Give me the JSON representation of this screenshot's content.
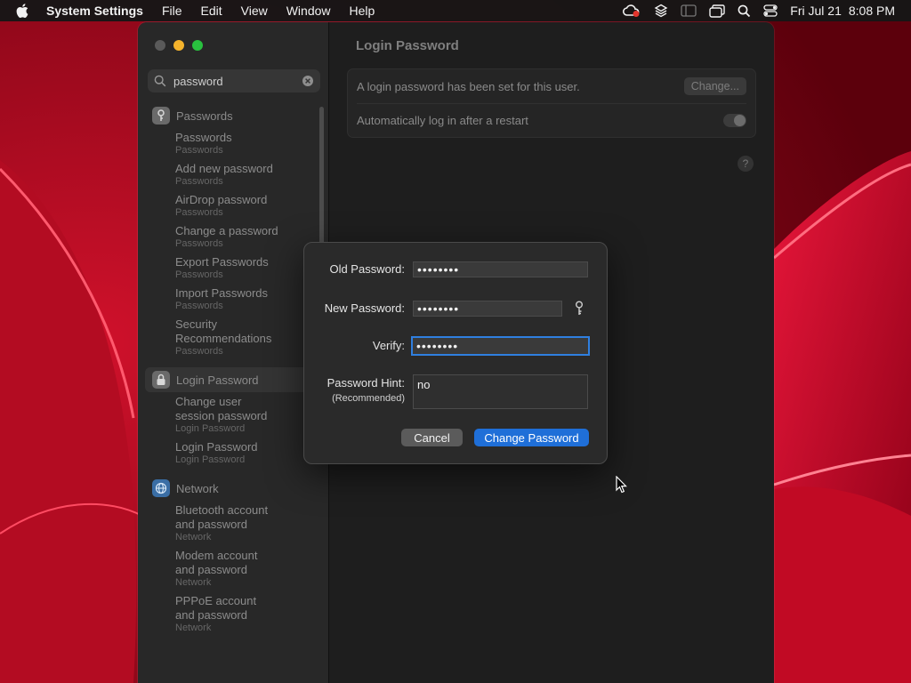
{
  "menubar": {
    "app_name": "System Settings",
    "menus": [
      "File",
      "Edit",
      "View",
      "Window",
      "Help"
    ],
    "date": "Fri Jul 21",
    "time": "8:08 PM"
  },
  "sidebar": {
    "search_value": "password",
    "groups": [
      {
        "category": "Passwords",
        "results": [
          {
            "title": "Passwords",
            "subtitle": "Passwords"
          },
          {
            "title": "Add new password",
            "subtitle": "Passwords"
          },
          {
            "title": "AirDrop password",
            "subtitle": "Passwords"
          },
          {
            "title": "Change a password",
            "subtitle": "Passwords"
          },
          {
            "title": "Export Passwords",
            "subtitle": "Passwords"
          },
          {
            "title": "Import Passwords",
            "subtitle": "Passwords"
          },
          {
            "title": "Security Recommendations",
            "subtitle": "Passwords"
          }
        ]
      },
      {
        "category": "Login Password",
        "results": [
          {
            "title": "Change user session password",
            "subtitle": "Login Password"
          },
          {
            "title": "Login Password",
            "subtitle": "Login Password"
          }
        ]
      },
      {
        "category": "Network",
        "results": [
          {
            "title": "Bluetooth account and password",
            "subtitle": "Network"
          },
          {
            "title": "Modem account and password",
            "subtitle": "Network"
          },
          {
            "title": "PPPoE account and password",
            "subtitle": "Network"
          }
        ]
      }
    ]
  },
  "detail": {
    "title": "Login Password",
    "password_set_text": "A login password has been set for this user.",
    "change_button": "Change...",
    "auto_login_text": "Automatically log in after a restart",
    "help": "?"
  },
  "dialog": {
    "old_password_label": "Old Password:",
    "old_password_value": "••••••••",
    "new_password_label": "New Password:",
    "new_password_value": "••••••••",
    "verify_label": "Verify:",
    "verify_value": "••••••••",
    "hint_label": "Password Hint:",
    "hint_sub": "(Recommended)",
    "hint_value": "no",
    "cancel": "Cancel",
    "submit": "Change Password"
  }
}
